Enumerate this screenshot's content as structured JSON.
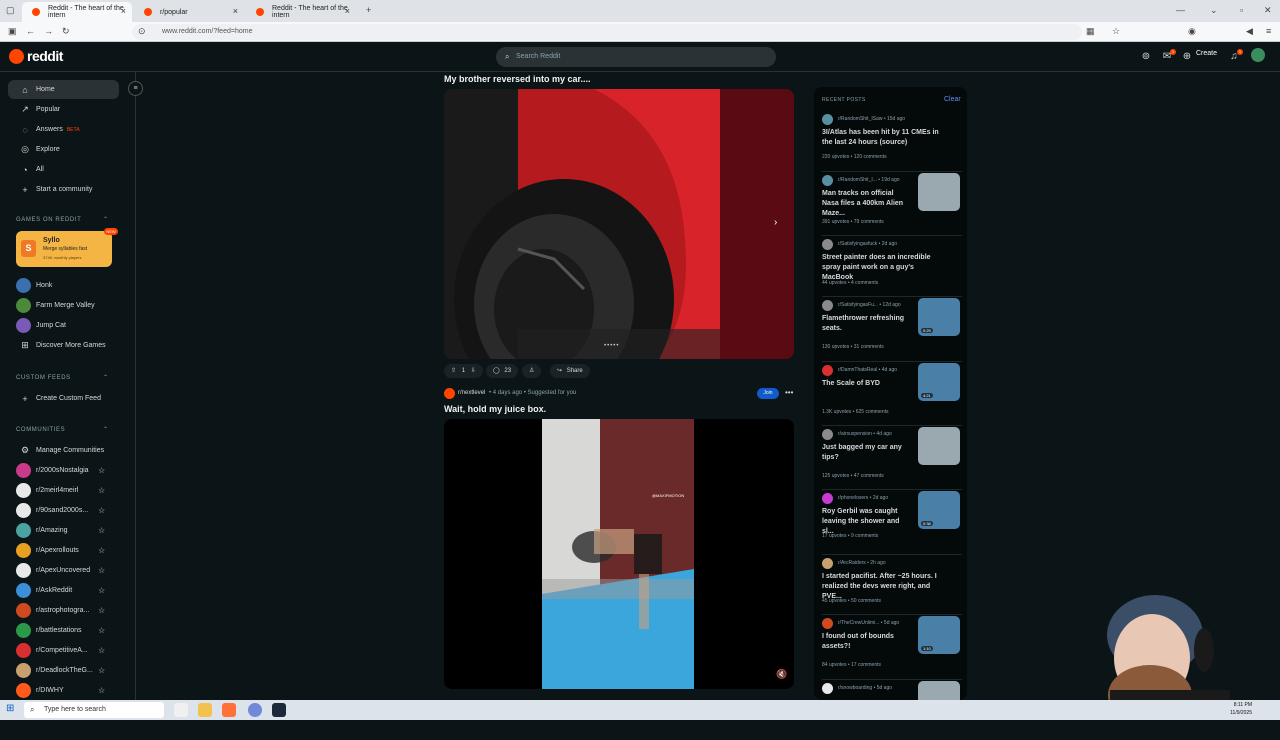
{
  "browser": {
    "tabs": [
      {
        "title": "Reddit - The heart of the intern"
      },
      {
        "title": "r/popular"
      },
      {
        "title": "Reddit - The heart of the intern"
      }
    ],
    "url": "www.reddit.com/?feed=home"
  },
  "header": {
    "logo": "reddit",
    "search_placeholder": "Search Reddit",
    "create_label": "Create",
    "chat_badge": "1",
    "notif_badge": "1"
  },
  "sidebar": {
    "nav": [
      {
        "label": "Home",
        "icon": "home-icon"
      },
      {
        "label": "Popular",
        "icon": "popular-icon"
      },
      {
        "label": "Answers",
        "badge": "BETA",
        "icon": "answers-icon"
      },
      {
        "label": "Explore",
        "icon": "explore-icon"
      },
      {
        "label": "All",
        "icon": "all-icon"
      },
      {
        "label": "Start a community",
        "icon": "plus-icon"
      }
    ],
    "games_section": "GAMES ON REDDIT",
    "featured_game": {
      "name": "Syllo",
      "desc": "Merge syllables fast",
      "players": "374K monthly players",
      "badge": "NEW"
    },
    "games": [
      "Honk",
      "Farm Merge Valley",
      "Jump Cat",
      "Discover More Games"
    ],
    "custom_feeds_section": "CUSTOM FEEDS",
    "create_custom_feed": "Create Custom Feed",
    "communities_section": "COMMUNITIES",
    "manage_communities": "Manage Communities",
    "communities": [
      {
        "name": "r/2000sNostalgia",
        "color": "#c93a8a"
      },
      {
        "name": "r/2meirl4meirl",
        "color": "#e8e8e8"
      },
      {
        "name": "r/90sand2000s...",
        "color": "#e8e8e8"
      },
      {
        "name": "r/Amazing",
        "color": "#4aa3a0"
      },
      {
        "name": "r/Apexrollouts",
        "color": "#e8a020"
      },
      {
        "name": "r/ApexUncovered",
        "color": "#e8e8e8"
      },
      {
        "name": "r/AskReddit",
        "color": "#3a8fd8"
      },
      {
        "name": "r/astrophotogra...",
        "color": "#d04a20"
      },
      {
        "name": "r/battlestations",
        "color": "#2a9a4a"
      },
      {
        "name": "r/CompetitiveA...",
        "color": "#d83030"
      },
      {
        "name": "r/DeadlockTheG...",
        "color": "#c8a070"
      },
      {
        "name": "r/DIWHY",
        "color": "#ff5a1a"
      }
    ]
  },
  "feed": {
    "post1": {
      "title": "My brother reversed into my car....",
      "votes": "1",
      "comments": "23",
      "share": "Share"
    },
    "post2": {
      "subreddit": "r/nextlevel",
      "meta": "• 4 days ago • Suggested for you",
      "join": "Join",
      "title": "Wait, hold my juice box.",
      "watermark": "@MAXIFMOTION"
    }
  },
  "recent_posts": {
    "heading": "RECENT POSTS",
    "clear": "Clear",
    "items": [
      {
        "sub": "r/RandomShit_ISaw • 15d ago",
        "title": "3I/Atlas has been hit by 11 CMEs in the last 24 hours (source)",
        "stats": "220 upvotes  •  120 comments",
        "color": "#5a8fa0"
      },
      {
        "sub": "r/RandomShit_I... • 19d ago",
        "title": "Man tracks on official Nasa files a 400km Alien Maze...",
        "stats": "391 upvotes  •  79 comments",
        "color": "#5a8fa0",
        "thumb": "photo"
      },
      {
        "sub": "r/Satisfyingasfuck • 2d ago",
        "title": "Street painter does an incredible spray paint work on a guy's MacBook",
        "stats": "44 upvotes  •  4 comments",
        "color": "#8a8a8a"
      },
      {
        "sub": "r/SatisfyingasFu... • 12d ago",
        "title": "Flamethrower refreshing seats.",
        "stats": "130 upvotes  •  31 comments",
        "color": "#8a8a8a",
        "thumb": "video",
        "duration": "0:29"
      },
      {
        "sub": "r/DamnThatsReal • 4d ago",
        "title": "The Scale of BYD",
        "stats": "1.3K upvotes  •  625 comments",
        "color": "#d83030",
        "thumb": "video",
        "duration": "4:21"
      },
      {
        "sub": "r/airsuspension • 4d ago",
        "title": "Just bagged my car any tips?",
        "stats": "125 upvotes  •  47 comments",
        "color": "#8a8a8a",
        "thumb": "photo"
      },
      {
        "sub": "r/phonelosers • 2d ago",
        "title": "Roy Gerbil was caught leaving the shower and sl...",
        "stats": "17 upvotes  •  9 comments",
        "color": "#c83ad0",
        "thumb": "video",
        "duration": "0:38"
      },
      {
        "sub": "r/ArcRaiders • 2h ago",
        "title": "I started pacifist. After ~25 hours. I realized the devs were right, and PVE...",
        "stats": "45 upvotes  •  50 comments",
        "color": "#c8a070"
      },
      {
        "sub": "r/TheCrewUnlimi... • 5d ago",
        "title": "I found out of bounds assets?!",
        "stats": "84 upvotes  •  17 comments",
        "color": "#d04a20",
        "thumb": "video",
        "duration": "1:10"
      },
      {
        "sub": "r/snowboarding • 5d ago",
        "title": "",
        "stats": "",
        "color": "#e8e8e8",
        "thumb": "photo"
      }
    ]
  },
  "taskbar": {
    "search_placeholder": "Type here to search",
    "time": "8:11 PM",
    "date": "11/9/2025"
  }
}
